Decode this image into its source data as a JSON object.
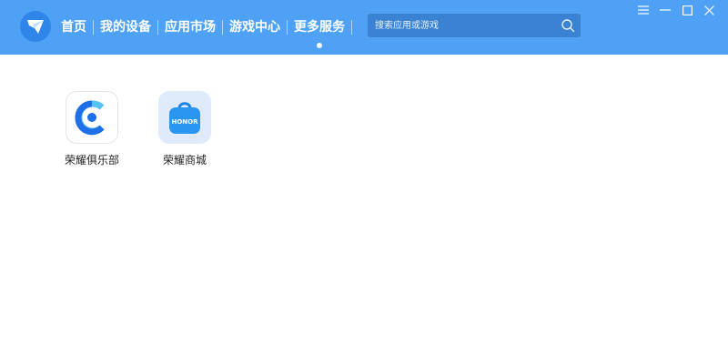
{
  "nav": {
    "items": [
      {
        "label": "首页",
        "active": false
      },
      {
        "label": "我的设备",
        "active": false
      },
      {
        "label": "应用市场",
        "active": false
      },
      {
        "label": "游戏中心",
        "active": false
      },
      {
        "label": "更多服务",
        "active": true
      }
    ]
  },
  "search": {
    "placeholder": "搜索应用或游戏",
    "icon": "search-icon"
  },
  "window_controls": [
    "menu-icon",
    "minimize-icon",
    "maximize-icon",
    "close-icon"
  ],
  "apps": [
    {
      "label": "荣耀俱乐部",
      "icon": "honor-club-icon"
    },
    {
      "label": "荣耀商城",
      "icon": "honor-mall-icon",
      "badge_text": "HONOR"
    }
  ],
  "colors": {
    "topbar": "#4ea1f5",
    "search_bg": "#3a82d2",
    "accent": "#1f7ef0"
  }
}
